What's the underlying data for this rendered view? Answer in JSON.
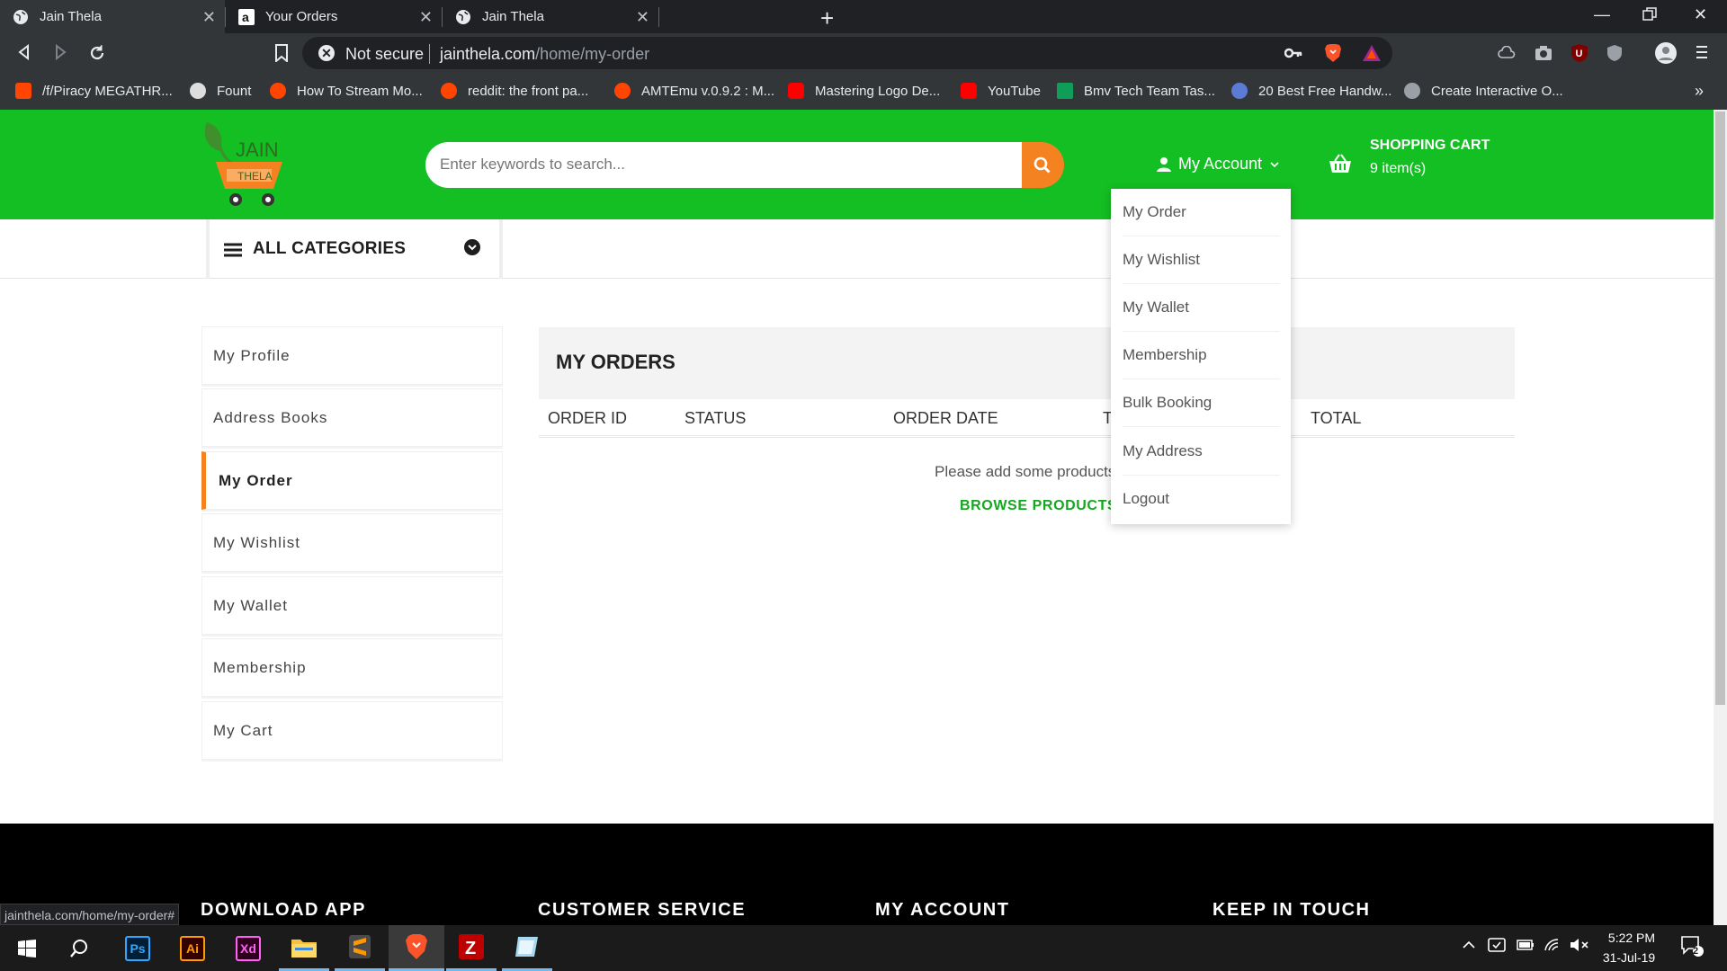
{
  "browser": {
    "tabs": [
      {
        "title": "Jain Thela",
        "active": true
      },
      {
        "title": "Your Orders",
        "active": false
      },
      {
        "title": "Jain Thela",
        "active": false
      }
    ],
    "security_label": "Not secure",
    "url_host": "jainthela.com",
    "url_path": "/home/my-order",
    "bookmarks": [
      {
        "label": "/f/Piracy MEGATHR...",
        "color": "#ff4500"
      },
      {
        "label": "Fount",
        "color": "#dddddd"
      },
      {
        "label": "How To Stream Mo...",
        "color": "#ff4500"
      },
      {
        "label": "reddit: the front pa...",
        "color": "#ff4500"
      },
      {
        "label": "AMTEmu v.0.9.2 : M...",
        "color": "#ff4500"
      },
      {
        "label": "Mastering Logo De...",
        "color": "#ff0000"
      },
      {
        "label": "YouTube",
        "color": "#ff0000"
      },
      {
        "label": "Bmv Tech Team Tas...",
        "color": "#0f9d58"
      },
      {
        "label": "20 Best Free Handw...",
        "color": "#5b7bd5"
      },
      {
        "label": "Create Interactive O...",
        "color": "#9aa0a6"
      }
    ],
    "status_url": "jainthela.com/home/my-order#"
  },
  "header": {
    "logo_top": "JAIN",
    "logo_bottom": "THELA",
    "search_placeholder": "Enter keywords to search...",
    "account_label": "My Account",
    "cart_title": "SHOPPING CART",
    "cart_count": "9 item(s)"
  },
  "category_bar": {
    "label": "ALL CATEGORIES"
  },
  "sidebar": {
    "items": [
      {
        "label": "My Profile",
        "active": false
      },
      {
        "label": "Address Books",
        "active": false
      },
      {
        "label": "My Order",
        "active": true
      },
      {
        "label": "My Wishlist",
        "active": false
      },
      {
        "label": "My Wallet",
        "active": false
      },
      {
        "label": "Membership",
        "active": false
      },
      {
        "label": "My Cart",
        "active": false
      }
    ]
  },
  "orders": {
    "title": "MY ORDERS",
    "columns": [
      "ORDER ID",
      "STATUS",
      "ORDER DATE",
      "T",
      "TOTAL"
    ],
    "empty_message": "Please add some products",
    "browse_label": "BROWSE PRODUCTS"
  },
  "account_menu": {
    "items": [
      "My Order",
      "My Wishlist",
      "My Wallet",
      "Membership",
      "Bulk Booking",
      "My Address",
      "Logout"
    ]
  },
  "footer": {
    "headings": [
      "DOWNLOAD APP",
      "CUSTOMER SERVICE",
      "MY ACCOUNT",
      "KEEP IN TOUCH"
    ]
  },
  "taskbar": {
    "apps": [
      {
        "name": "photoshop",
        "label": "Ps"
      },
      {
        "name": "illustrator",
        "label": "Ai"
      },
      {
        "name": "xd",
        "label": "Xd"
      },
      {
        "name": "file-explorer",
        "label": ""
      },
      {
        "name": "sublime-text",
        "label": ""
      },
      {
        "name": "brave-browser",
        "label": ""
      },
      {
        "name": "filezilla",
        "label": ""
      },
      {
        "name": "notes",
        "label": ""
      }
    ],
    "time": "5:22 PM",
    "date": "31-Jul-19",
    "notification_count": "2"
  },
  "colors": {
    "brand_green": "#13bf22",
    "accent_orange": "#f58220",
    "link_green": "#13a81e"
  }
}
